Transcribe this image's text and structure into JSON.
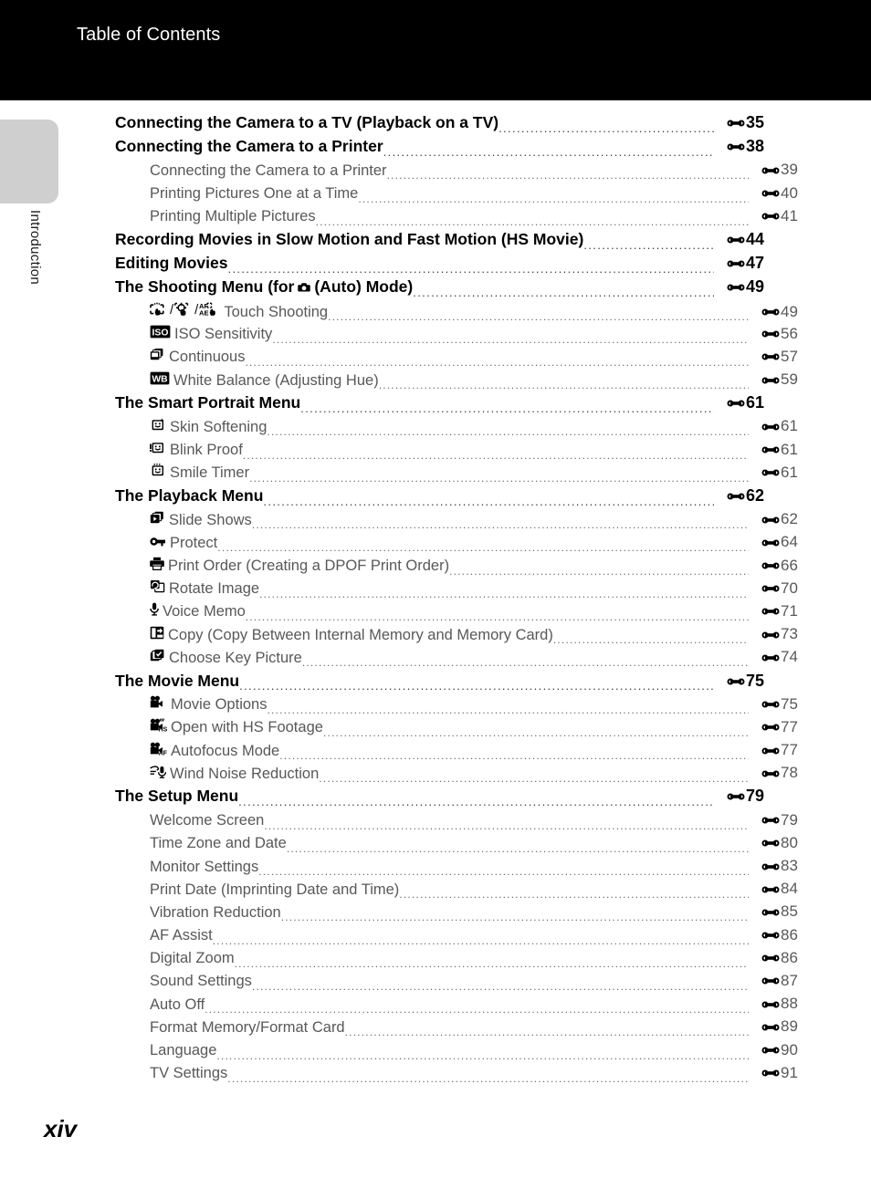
{
  "header": {
    "title": "Table of Contents"
  },
  "sidebar": {
    "chapter_label": "Introduction"
  },
  "footer": {
    "folio": "xiv"
  },
  "toc": {
    "page_prefix_symbol": "E",
    "entries": [
      {
        "level": 1,
        "icon": null,
        "label": "Connecting the Camera to a TV (Playback on a TV)",
        "page": "35"
      },
      {
        "level": 1,
        "icon": null,
        "label": "Connecting the Camera to a Printer",
        "page": "38"
      },
      {
        "level": 2,
        "icon": null,
        "label": "Connecting the Camera to a Printer",
        "page": "39"
      },
      {
        "level": 2,
        "icon": null,
        "label": "Printing Pictures One at a Time",
        "page": "40"
      },
      {
        "level": 2,
        "icon": null,
        "label": "Printing Multiple Pictures",
        "page": "41"
      },
      {
        "level": 1,
        "icon": null,
        "label": "Recording Movies in Slow Motion and Fast Motion (HS Movie)",
        "page": "44"
      },
      {
        "level": 1,
        "icon": null,
        "label": "Editing Movies",
        "page": "47"
      },
      {
        "level": 1,
        "icon": "camera-auto-mode-icon",
        "label_pre": "The Shooting Menu (for ",
        "label_post": " (Auto) Mode)",
        "label": "The Shooting Menu (for  (Auto) Mode)",
        "page": "49"
      },
      {
        "level": 2,
        "icon": "touch-shooting-icon-group",
        "label": "Touch Shooting",
        "page": "49"
      },
      {
        "level": 2,
        "icon": "iso-sensitivity-icon",
        "label": "ISO Sensitivity",
        "page": "56"
      },
      {
        "level": 2,
        "icon": "continuous-icon",
        "label": "Continuous",
        "page": "57"
      },
      {
        "level": 2,
        "icon": "white-balance-icon",
        "label": "White Balance (Adjusting Hue)",
        "page": "59"
      },
      {
        "level": 1,
        "icon": null,
        "label": "The Smart Portrait Menu",
        "page": "61"
      },
      {
        "level": 2,
        "icon": "skin-softening-icon",
        "label": "Skin Softening",
        "page": "61"
      },
      {
        "level": 2,
        "icon": "blink-proof-icon",
        "label": "Blink Proof",
        "page": "61"
      },
      {
        "level": 2,
        "icon": "smile-timer-icon",
        "label": "Smile Timer",
        "page": "61"
      },
      {
        "level": 1,
        "icon": null,
        "label": "The Playback Menu",
        "page": "62"
      },
      {
        "level": 2,
        "icon": "slide-show-icon",
        "label": "Slide Shows",
        "page": "62"
      },
      {
        "level": 2,
        "icon": "protect-key-icon",
        "label": "Protect",
        "page": "64"
      },
      {
        "level": 2,
        "icon": "print-order-icon",
        "label": "Print Order (Creating a DPOF Print Order)",
        "page": "66"
      },
      {
        "level": 2,
        "icon": "rotate-image-icon",
        "label": "Rotate Image",
        "page": "70"
      },
      {
        "level": 2,
        "icon": "voice-memo-icon",
        "label": "Voice Memo",
        "page": "71"
      },
      {
        "level": 2,
        "icon": "copy-icon",
        "label": "Copy (Copy Between Internal Memory and Memory Card)",
        "page": "73"
      },
      {
        "level": 2,
        "icon": "choose-key-picture-icon",
        "label": "Choose Key Picture",
        "page": "74"
      },
      {
        "level": 1,
        "icon": null,
        "label": "The Movie Menu",
        "page": "75"
      },
      {
        "level": 2,
        "icon": "movie-options-icon",
        "label": "Movie Options",
        "page": "75"
      },
      {
        "level": 2,
        "icon": "open-with-hs-footage-icon",
        "label": "Open with HS Footage",
        "page": "77"
      },
      {
        "level": 2,
        "icon": "autofocus-mode-icon",
        "label": "Autofocus Mode",
        "page": "77"
      },
      {
        "level": 2,
        "icon": "wind-noise-reduction-icon",
        "label": "Wind Noise Reduction",
        "page": "78"
      },
      {
        "level": 1,
        "icon": null,
        "label": "The Setup Menu",
        "page": "79"
      },
      {
        "level": 2,
        "icon": null,
        "label": "Welcome Screen",
        "page": "79"
      },
      {
        "level": 2,
        "icon": null,
        "label": "Time Zone and Date",
        "page": "80"
      },
      {
        "level": 2,
        "icon": null,
        "label": "Monitor Settings",
        "page": "83"
      },
      {
        "level": 2,
        "icon": null,
        "label": "Print Date (Imprinting Date and Time)",
        "page": "84"
      },
      {
        "level": 2,
        "icon": null,
        "label": "Vibration Reduction",
        "page": "85"
      },
      {
        "level": 2,
        "icon": null,
        "label": "AF Assist",
        "page": "86"
      },
      {
        "level": 2,
        "icon": null,
        "label": "Digital Zoom",
        "page": "86"
      },
      {
        "level": 2,
        "icon": null,
        "label": "Sound Settings",
        "page": "87"
      },
      {
        "level": 2,
        "icon": null,
        "label": "Auto Off",
        "page": "88"
      },
      {
        "level": 2,
        "icon": null,
        "label": "Format Memory/Format Card",
        "page": "89"
      },
      {
        "level": 2,
        "icon": null,
        "label": "Language",
        "page": "90"
      },
      {
        "level": 2,
        "icon": null,
        "label": "TV Settings",
        "page": "91"
      }
    ]
  }
}
